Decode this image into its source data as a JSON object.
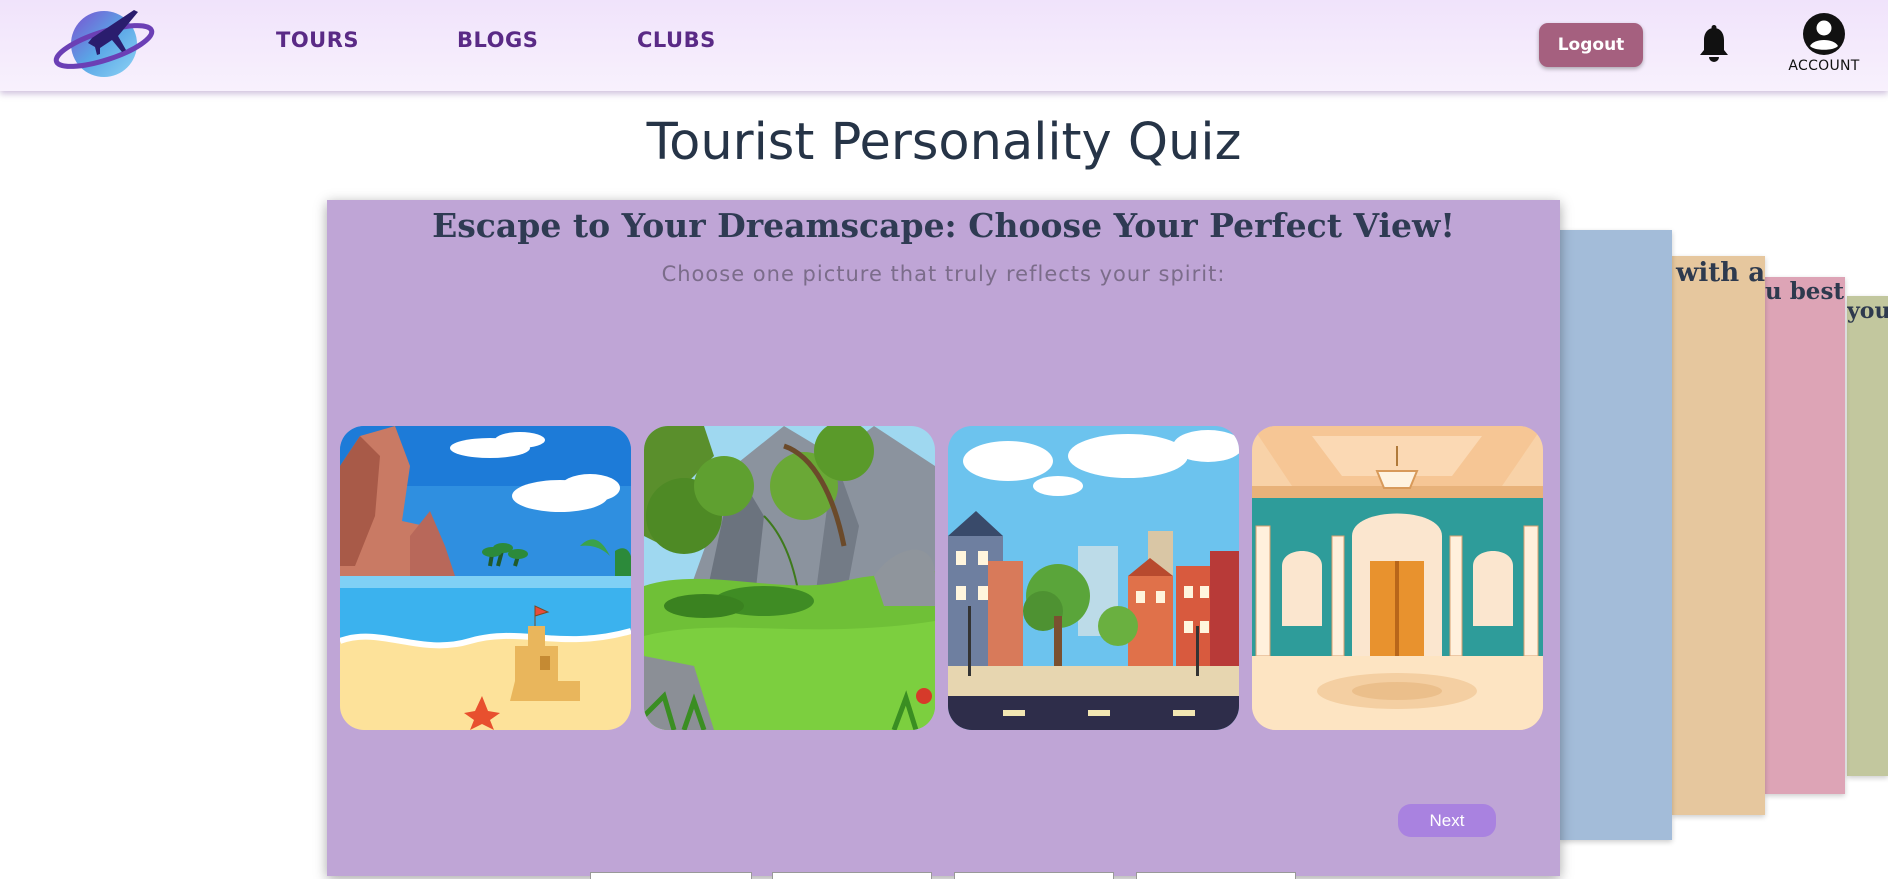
{
  "nav": {
    "logo_icon": "plane-globe-logo",
    "links": [
      "TOURS",
      "BLOGS",
      "CLUBS"
    ],
    "logout_label": "Logout",
    "bell_icon": "bell-icon",
    "account_label": "ACCOUNT"
  },
  "page": {
    "title": "Tourist Personality Quiz"
  },
  "quiz": {
    "question": "Escape to Your Dreamscape: Choose Your Perfect View!",
    "subtitle": "Choose one picture that truly reflects your spirit:",
    "choices": [
      {
        "name": "beach-scene"
      },
      {
        "name": "mountain-forest-scene"
      },
      {
        "name": "city-street-scene"
      },
      {
        "name": "palace-hall-scene"
      }
    ],
    "next_label": "Next"
  },
  "stacked_cards": {
    "card2_text": "with a",
    "card3_text": "u best!",
    "card4_text": "you",
    "colors": [
      "#a3bcd9",
      "#e6c79e",
      "#dda4b6",
      "#c2c79e"
    ]
  },
  "colors": {
    "nav_text": "#5a2a86",
    "logout_bg": "#a5607f",
    "card_bg": "#bfa5d6",
    "next_bg": "#a982e0",
    "title": "#263447"
  }
}
